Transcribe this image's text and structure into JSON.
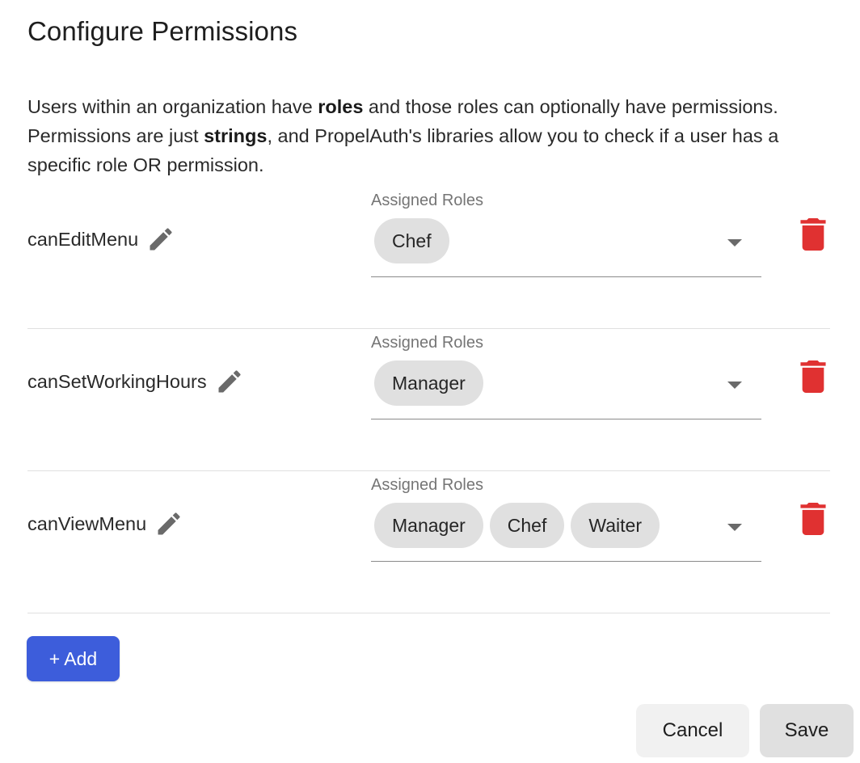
{
  "dialog": {
    "title": "Configure Permissions",
    "description": {
      "part1": "Users within an organization have ",
      "bold1": "roles",
      "part2": " and those roles can optionally have permissions. Permissions are just ",
      "bold2": "strings",
      "part3": ", and PropelAuth's libraries allow you to check if a user has a specific role OR permission."
    }
  },
  "permissions": [
    {
      "name": "canEditMenu",
      "roles_label": "Assigned Roles",
      "roles": [
        "Chef"
      ]
    },
    {
      "name": "canSetWorkingHours",
      "roles_label": "Assigned Roles",
      "roles": [
        "Manager"
      ]
    },
    {
      "name": "canViewMenu",
      "roles_label": "Assigned Roles",
      "roles": [
        "Manager",
        "Chef",
        "Waiter"
      ]
    }
  ],
  "actions": {
    "add_label": "+ Add",
    "cancel_label": "Cancel",
    "save_label": "Save"
  },
  "colors": {
    "primary": "#3d5ddb",
    "delete": "#e03131",
    "chip": "#e0e0e0",
    "icon": "#6a6a6a"
  },
  "icons": {
    "edit": "pencil-icon",
    "delete": "trash-icon",
    "dropdown": "caret-down-icon"
  }
}
